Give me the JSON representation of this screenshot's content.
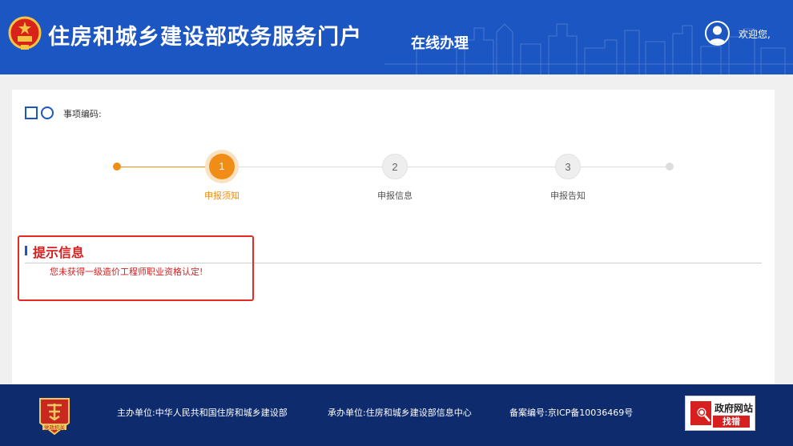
{
  "header": {
    "site_title": "住房和城乡建设部政务服务门户",
    "section_title": "在线办理",
    "welcome": "欢迎您,"
  },
  "item": {
    "code_label": "事项编码:"
  },
  "steps": [
    {
      "number": "1",
      "label": "申报须知",
      "state": "active"
    },
    {
      "number": "2",
      "label": "申报信息",
      "state": "inactive"
    },
    {
      "number": "3",
      "label": "申报告知",
      "state": "inactive"
    }
  ],
  "hint": {
    "title": "提示信息",
    "message": "您未获得一级造价工程师职业资格认定!"
  },
  "footer": {
    "host": "主办单位:中华人民共和国住房和城乡建设部",
    "organizer": "承办单位:住房和城乡建设部信息中心",
    "icp": "备案编号:京ICP备10036469号",
    "badge_text": "党政机关",
    "find_error_title": "政府网站",
    "find_error_sub": "找错"
  },
  "colors": {
    "header_blue": "#1c56c2",
    "footer_navy": "#0e2b6d",
    "accent_orange": "#f08d16",
    "alert_red": "#d81f1f"
  }
}
